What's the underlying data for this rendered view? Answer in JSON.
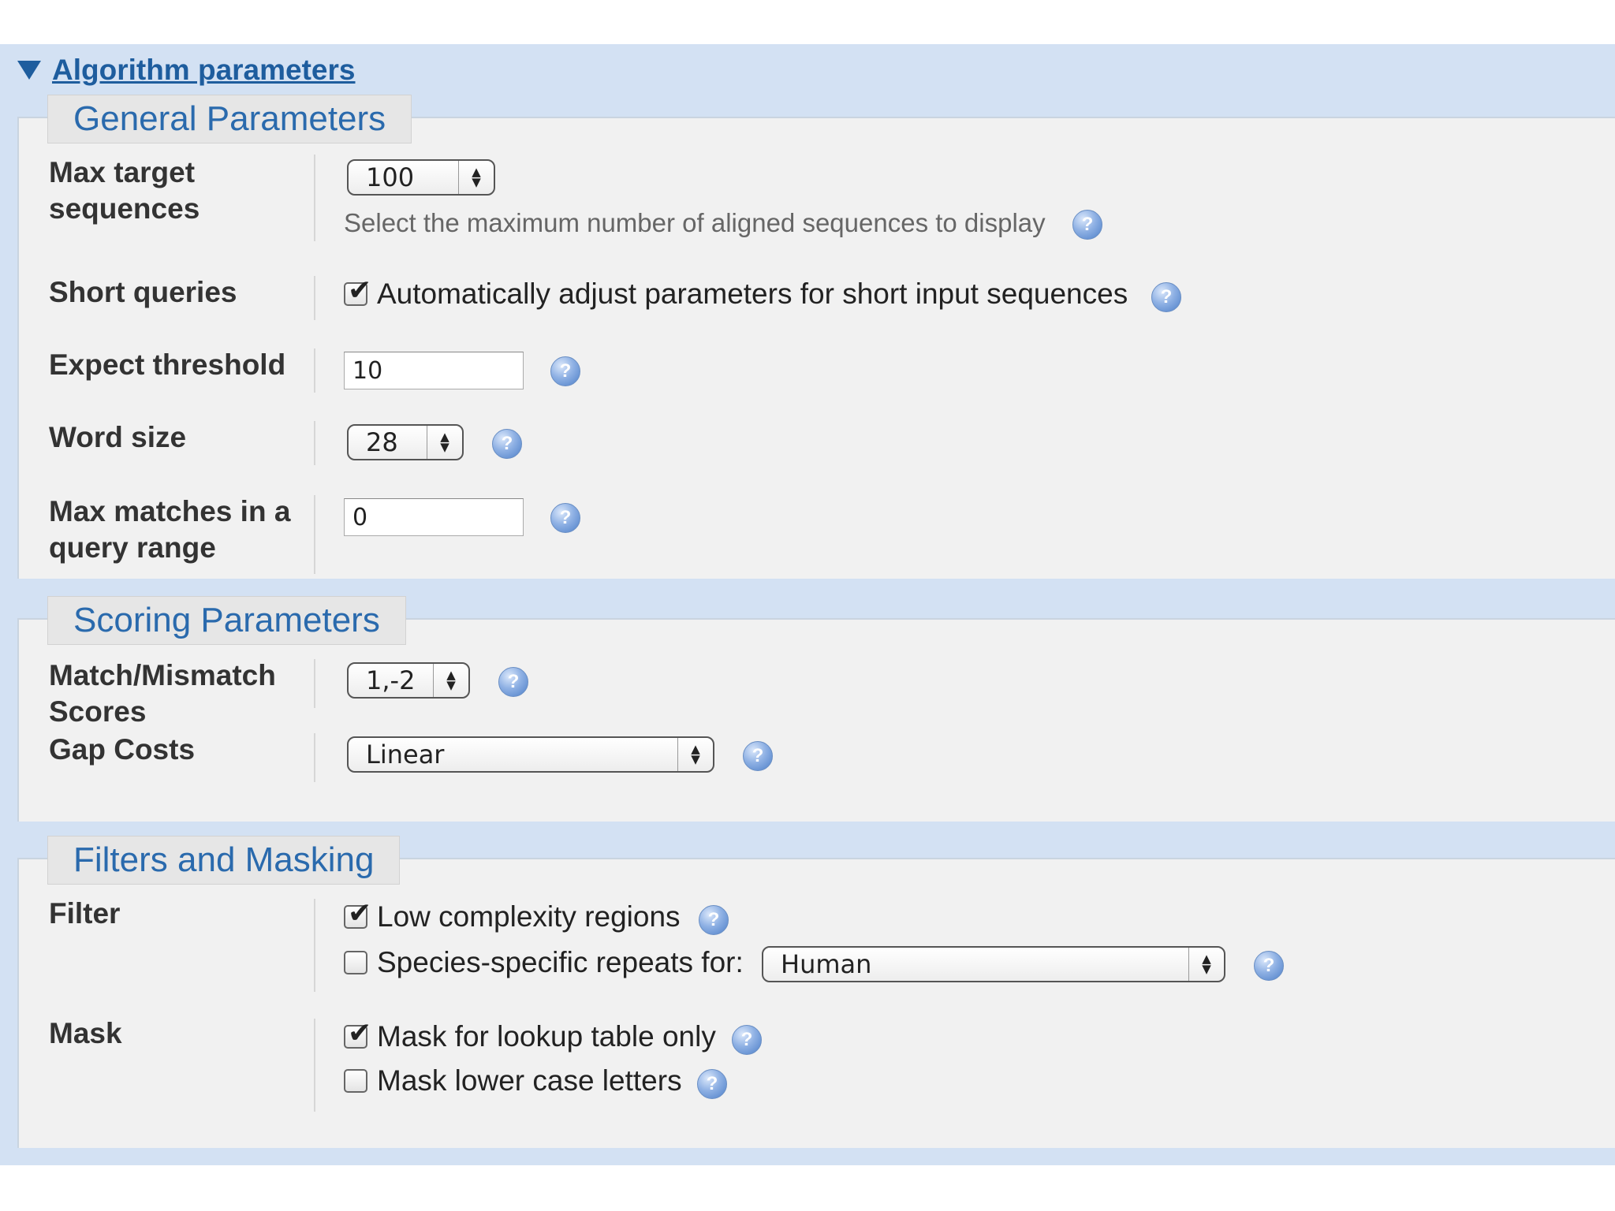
{
  "header": {
    "toggle_label": "Algorithm parameters"
  },
  "general": {
    "legend": "General Parameters",
    "max_target": {
      "label_line1": "Max target",
      "label_line2": "sequences",
      "value": "100",
      "hint": "Select the maximum number of aligned sequences to display"
    },
    "short_queries": {
      "label": "Short queries",
      "checkbox_label": "Automatically adjust parameters for short input sequences",
      "checked": true
    },
    "expect_threshold": {
      "label": "Expect threshold",
      "value": "10"
    },
    "word_size": {
      "label": "Word size",
      "value": "28"
    },
    "max_matches": {
      "label_line1": "Max matches in a",
      "label_line2": "query range",
      "value": "0"
    }
  },
  "scoring": {
    "legend": "Scoring Parameters",
    "match_mismatch": {
      "label_line1": "Match/Mismatch",
      "label_line2": "Scores",
      "value": "1,-2"
    },
    "gap_costs": {
      "label": "Gap Costs",
      "value": "Linear"
    }
  },
  "filters": {
    "legend": "Filters and Masking",
    "filter": {
      "label": "Filter",
      "low_complexity": {
        "label": "Low complexity regions",
        "checked": true
      },
      "species_repeats": {
        "label": "Species-specific repeats for:",
        "checked": false,
        "species": "Human"
      }
    },
    "mask": {
      "label": "Mask",
      "lookup_table": {
        "label": "Mask for lookup table only",
        "checked": true
      },
      "lower_case": {
        "label": "Mask lower case letters",
        "checked": false
      }
    }
  },
  "icons": {
    "help": "help-icon",
    "collapse": "triangle-down-icon"
  },
  "colors": {
    "band": "#d3e1f3",
    "panel": "#f1f1f1",
    "link": "#1e5d9e",
    "legend_text": "#2a6aad"
  }
}
